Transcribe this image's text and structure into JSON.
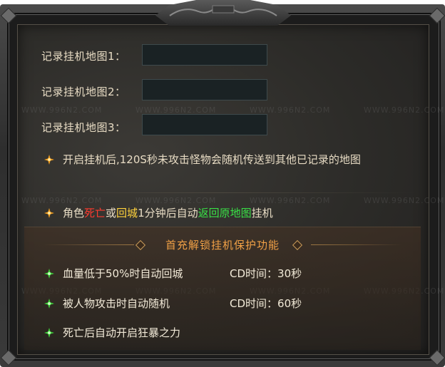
{
  "map_fields": [
    {
      "label": "记录挂机地图1：",
      "value": ""
    },
    {
      "label": "记录挂机地图2：",
      "value": ""
    },
    {
      "label": "记录挂机地图3：",
      "value": ""
    }
  ],
  "tips": {
    "tip1": "开启挂机后,120S秒未攻击怪物会随机传送到其他已记录的地图",
    "tip2_parts": {
      "p1": "角色",
      "death": "死亡",
      "p2": "或",
      "return_city": "回城",
      "p3": "1分钟后自动",
      "return_map": "返回原地图",
      "p4": "挂机"
    }
  },
  "section_title": "首充解锁挂机保护功能",
  "features": [
    {
      "text": "血量低于50%时自动回城",
      "cd": "CD时间：30秒"
    },
    {
      "text": "被人物攻击时自动随机",
      "cd": "CD时间：60秒"
    },
    {
      "text": "死亡后自动开启狂暴之力",
      "cd": ""
    }
  ],
  "watermark": "WWW.996N2.COM",
  "colors": {
    "label": "#e8dcc4",
    "red": "#ff3b2f",
    "yellow": "#ffd23c",
    "green": "#39e046",
    "section_title": "#f0a046",
    "bullet_orange": "#f5a020",
    "bullet_green": "#3fd43a"
  },
  "icons": {
    "tip_bullet": "orange-star-icon",
    "feature_bullet": "green-star-icon"
  }
}
